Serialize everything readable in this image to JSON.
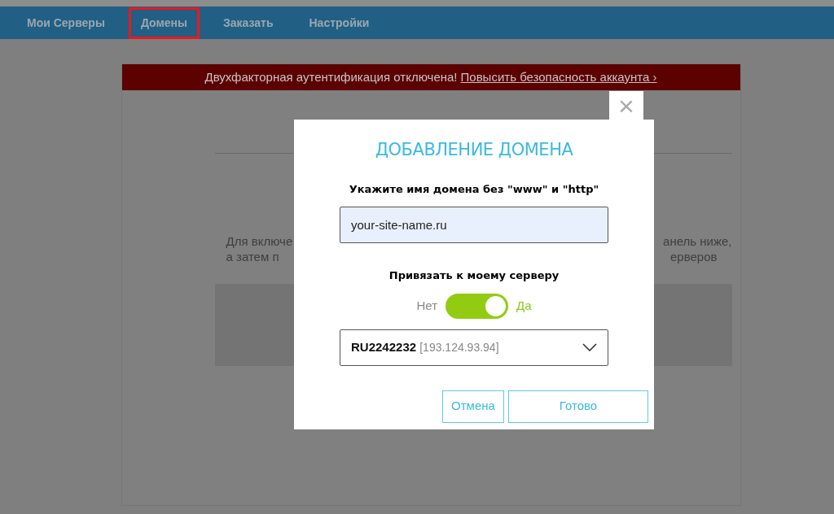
{
  "nav": [
    {
      "label": "Мои Серверы",
      "selected": false
    },
    {
      "label": "Домены",
      "selected": true
    },
    {
      "label": "Заказать",
      "selected": false
    },
    {
      "label": "Настройки",
      "selected": false
    }
  ],
  "banner": {
    "text": "Двухфакторная аутентификация отключена!",
    "link": "Повысить безопасность аккаунта ›"
  },
  "page": {
    "text_left": [
      "Для включе",
      "а затем п"
    ],
    "text_right": [
      "анель ниже,",
      "ерверов"
    ]
  },
  "dialog": {
    "close": "×",
    "title": "ДОБАВЛЕНИЕ ДОМЕНА",
    "domain_label": "Укажите имя домена без \"www\" и \"http\"",
    "domain_value": "your-site-name.ru",
    "bind_label": "Привязать к моему серверу",
    "toggle": {
      "off_label": "Нет",
      "on_label": "Да",
      "on": true
    },
    "server": {
      "name": "RU2242232",
      "ip": "[193.124.93.94]"
    },
    "buttons": [
      {
        "label": "Отмена",
        "kind": "cancel"
      },
      {
        "label": "Готово",
        "kind": "confirm"
      }
    ]
  }
}
